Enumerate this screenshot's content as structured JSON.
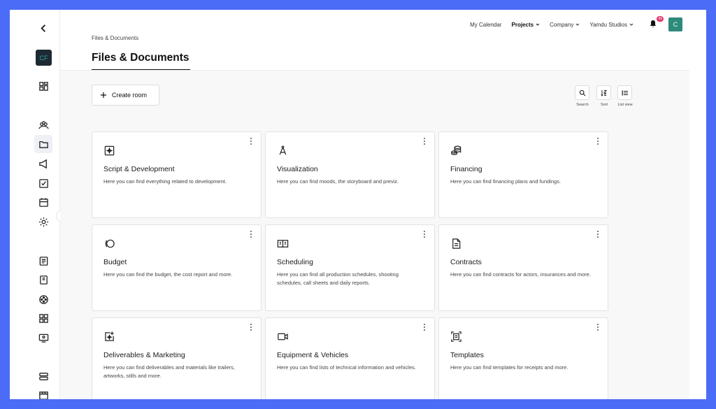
{
  "sidebar": {
    "avatar_label": "CF",
    "icons": [
      "chevron-left-icon",
      "dashboard-icon",
      "people-icon",
      "folder-icon",
      "megaphone-icon",
      "checkbox-icon",
      "calendar-icon",
      "settings-icon",
      "document-list-icon",
      "notebook-icon",
      "film-reel-icon",
      "grid-icon",
      "presentation-icon",
      "stack-icon",
      "clapperboard-icon",
      "chevron-right-icon"
    ]
  },
  "topnav": {
    "calendar": "My Calendar",
    "projects": "Projects",
    "company": "Company",
    "studio": "Yamdu Studios",
    "notification_count": "99",
    "user_initial": "C"
  },
  "breadcrumb": "Files & Documents",
  "page_title": "Files & Documents",
  "toolbar": {
    "create_room": "Create room",
    "search": "Search",
    "sort": "Sort",
    "list_view": "List view"
  },
  "cards": [
    {
      "icon": "script-icon",
      "title": "Script & Development",
      "desc": "Here you can find everything related to development."
    },
    {
      "icon": "compass-icon",
      "title": "Visualization",
      "desc": "Here you can find moods, the storyboard and previz."
    },
    {
      "icon": "coins-icon",
      "title": "Financing",
      "desc": "Here you can find financing plans and fundings."
    },
    {
      "icon": "budget-icon",
      "title": "Budget",
      "desc": "Here you can find the budget, the cost report and more."
    },
    {
      "icon": "schedule-book-icon",
      "title": "Scheduling",
      "desc": "Here you can find all production schedules, shooting schedules, call sheets and daily reports."
    },
    {
      "icon": "contract-icon",
      "title": "Contracts",
      "desc": "Here you can find contracts for actors, insurances and more."
    },
    {
      "icon": "deliverables-icon",
      "title": "Deliverables & Marketing",
      "desc": "Here you can find deliverables and materials like trailers, artworks, stills and more."
    },
    {
      "icon": "video-camera-icon",
      "title": "Equipment & Vehicles",
      "desc": "Here you can find lists of technical information and vehicles."
    },
    {
      "icon": "template-icon",
      "title": "Templates",
      "desc": "Here you can find templates for receipts and more."
    }
  ]
}
